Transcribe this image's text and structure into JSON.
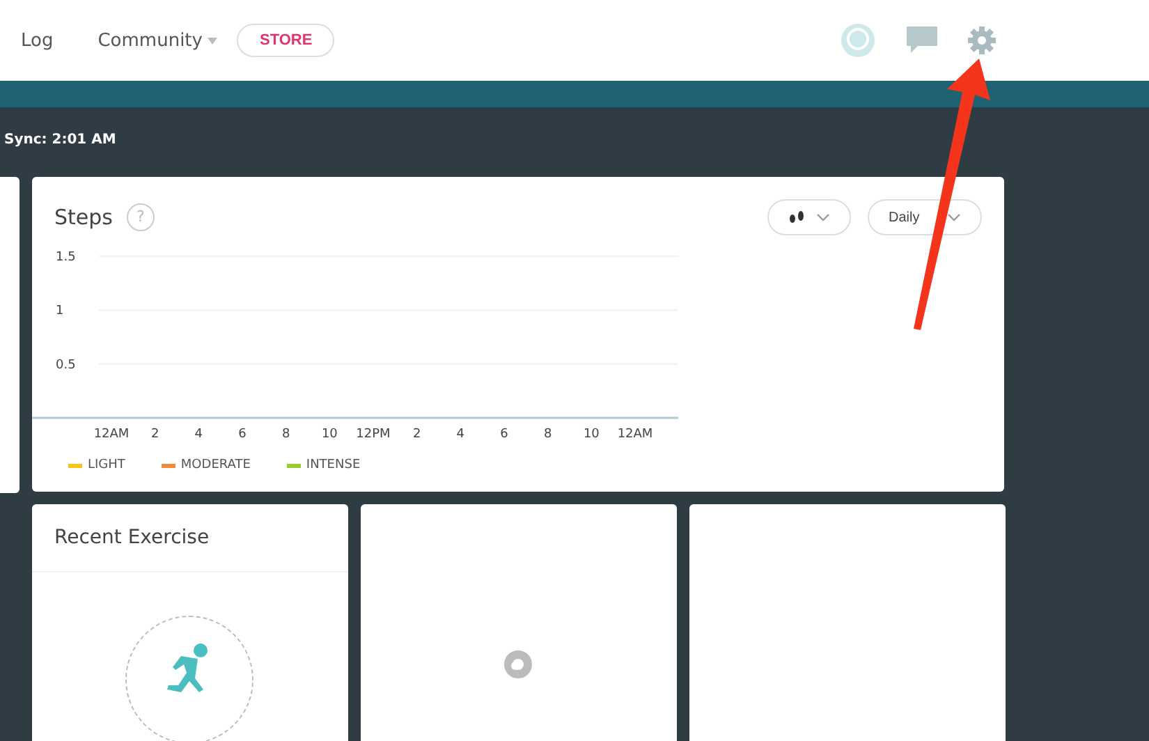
{
  "nav": {
    "items": [
      {
        "label": "Log",
        "kind": "link"
      },
      {
        "label": "Community",
        "kind": "dropdown"
      },
      {
        "label": "STORE",
        "kind": "pill"
      }
    ]
  },
  "sync": {
    "text": "Sync: 2:01 AM"
  },
  "steps_card": {
    "title": "Steps",
    "help": "?",
    "period": "Daily",
    "chart_data": {
      "type": "bar",
      "categories": [
        "12AM",
        "2",
        "4",
        "6",
        "8",
        "10",
        "12PM",
        "2",
        "4",
        "6",
        "8",
        "10",
        "12AM"
      ],
      "ylim": [
        0,
        1.5
      ],
      "yticks": [
        0.5,
        1,
        1.5
      ],
      "series": [
        {
          "name": "LIGHT",
          "color": "#f5c518",
          "values": [
            null,
            null,
            null,
            null,
            null,
            null,
            null,
            null,
            null,
            null,
            null,
            null,
            null
          ]
        },
        {
          "name": "MODERATE",
          "color": "#f08a3a",
          "values": [
            null,
            null,
            null,
            null,
            null,
            null,
            null,
            null,
            null,
            null,
            null,
            null,
            null
          ]
        },
        {
          "name": "INTENSE",
          "color": "#9acd32",
          "values": [
            null,
            null,
            null,
            null,
            null,
            null,
            null,
            null,
            null,
            null,
            null,
            null,
            null
          ]
        }
      ]
    }
  },
  "cards": [
    {
      "kind": "exercise",
      "title": "Recent Exercise"
    },
    {
      "kind": "loading"
    },
    {
      "kind": "blank"
    }
  ]
}
